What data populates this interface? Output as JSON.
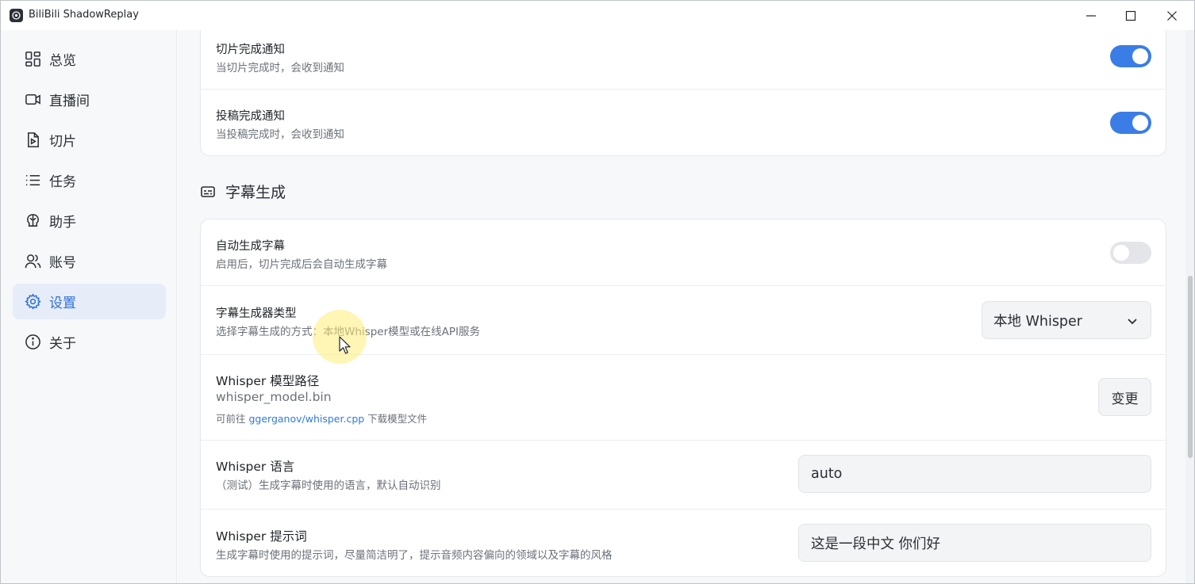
{
  "window": {
    "title": "BiliBili ShadowReplay"
  },
  "sidebar": {
    "items": [
      {
        "label": "总览",
        "icon": "dashboard-icon"
      },
      {
        "label": "直播间",
        "icon": "video-camera-icon"
      },
      {
        "label": "切片",
        "icon": "play-file-icon"
      },
      {
        "label": "任务",
        "icon": "list-icon"
      },
      {
        "label": "助手",
        "icon": "brain-icon"
      },
      {
        "label": "账号",
        "icon": "users-icon"
      },
      {
        "label": "设置",
        "icon": "gear-icon",
        "active": true
      },
      {
        "label": "关于",
        "icon": "info-icon"
      }
    ]
  },
  "notifications": {
    "clip_done": {
      "title": "切片完成通知",
      "desc": "当切片完成时，会收到通知",
      "enabled": true
    },
    "upload_done": {
      "title": "投稿完成通知",
      "desc": "当投稿完成时，会收到通知",
      "enabled": true
    }
  },
  "subtitles": {
    "section_title": "字幕生成",
    "auto_generate": {
      "title": "自动生成字幕",
      "desc": "启用后，切片完成后会自动生成字幕",
      "enabled": false
    },
    "generator_type": {
      "title": "字幕生成器类型",
      "desc": "选择字幕生成的方式：本地Whisper模型或在线API服务",
      "value": "本地 Whisper"
    },
    "model_path": {
      "title": "Whisper 模型路径",
      "value": "whisper_model.bin",
      "hint_prefix": "可前往 ",
      "hint_link": "ggerganov/whisper.cpp",
      "hint_suffix": " 下载模型文件",
      "button": "变更"
    },
    "language": {
      "title": "Whisper 语言",
      "desc": "（测试）生成字幕时使用的语言，默认自动识别",
      "value": "auto"
    },
    "prompt": {
      "title": "Whisper 提示词",
      "desc": "生成字幕时使用的提示词，尽量简洁明了，提示音频内容偏向的领域以及字幕的风格",
      "value": "这是一段中文 你们好"
    }
  },
  "colors": {
    "accent": "#3b7de6",
    "active_nav_bg": "#e6edf9",
    "link": "#2f7bd9"
  }
}
